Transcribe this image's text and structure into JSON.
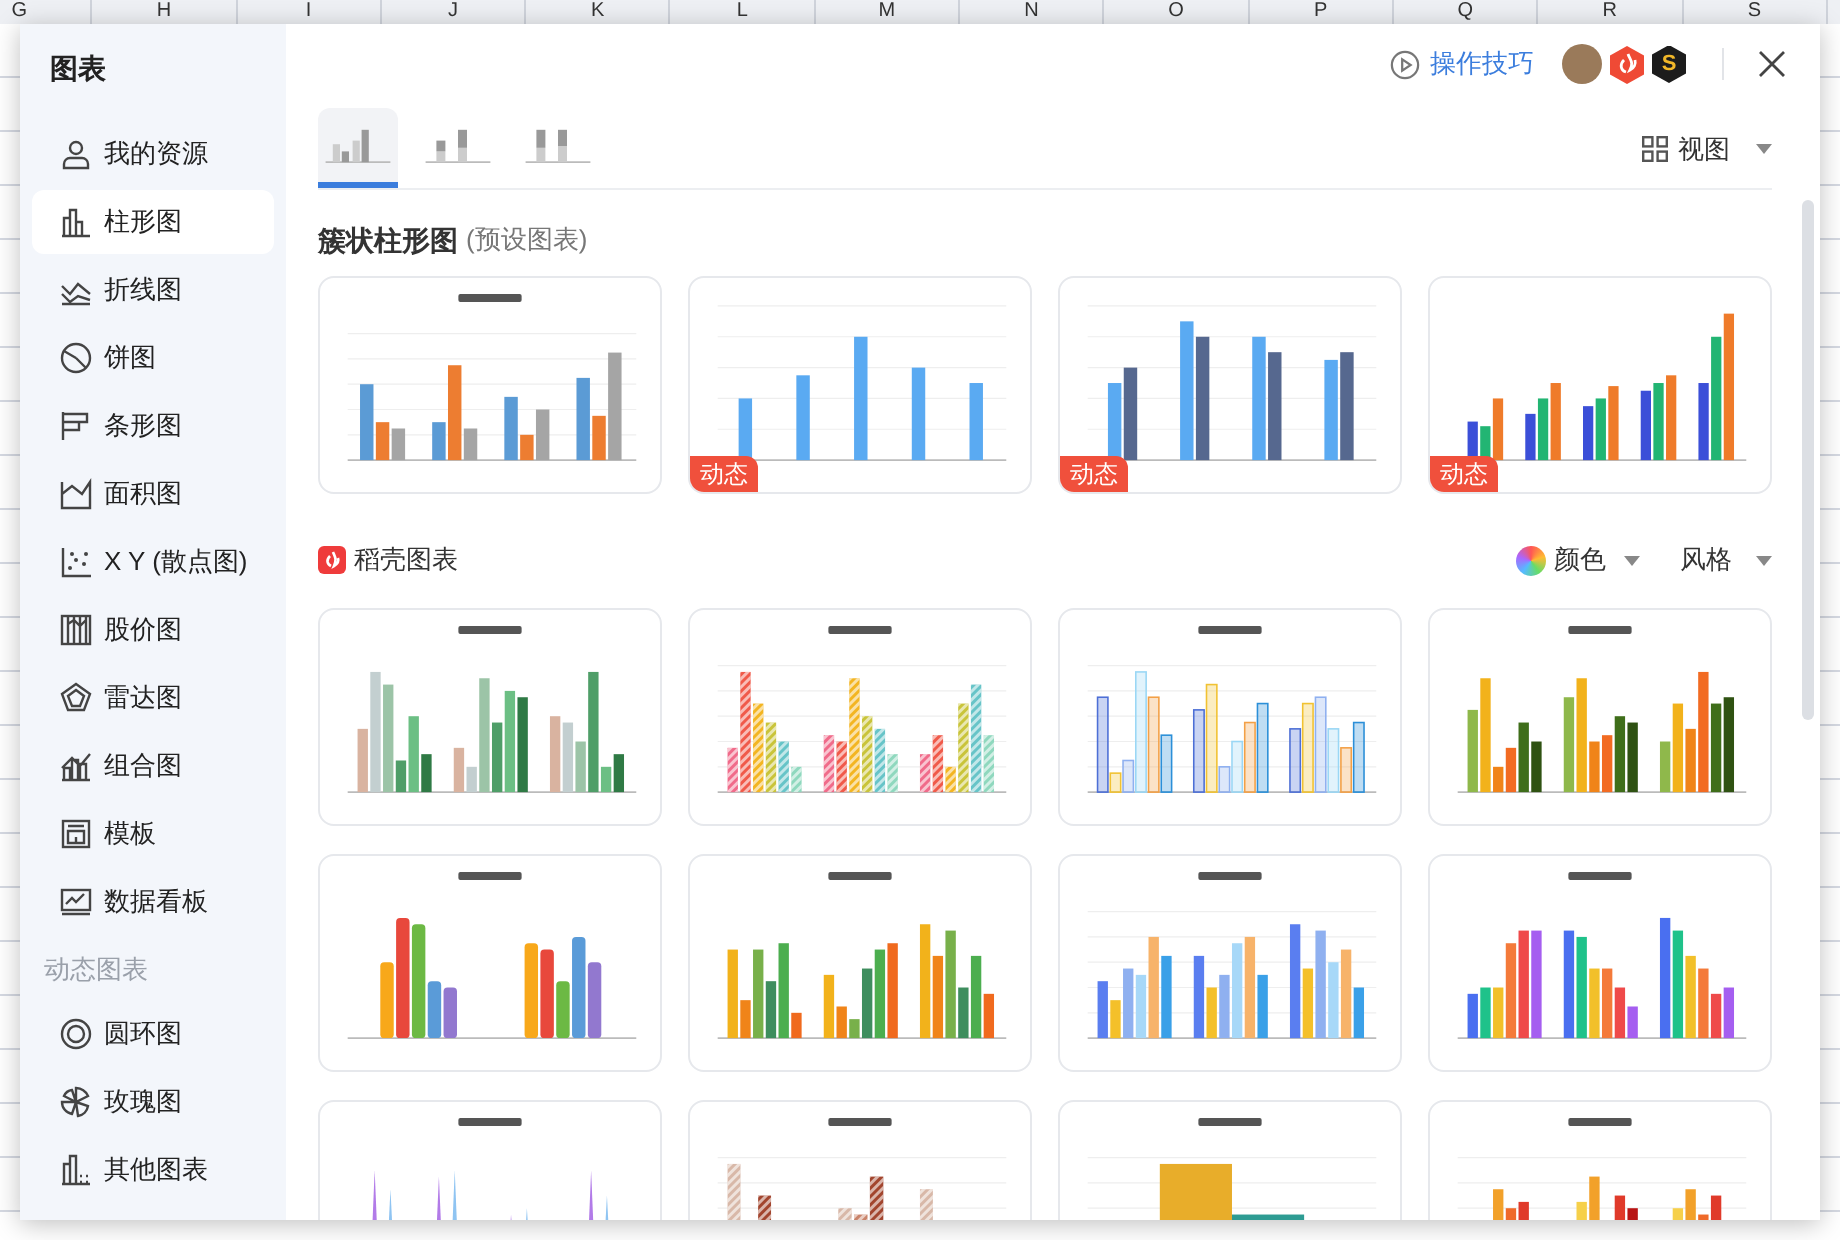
{
  "spreadsheet": {
    "column_headers": [
      "G",
      "H",
      "I",
      "J",
      "K",
      "L",
      "M",
      "N",
      "O",
      "P",
      "Q",
      "R",
      "S"
    ]
  },
  "dialog": {
    "title": "图表",
    "tips_link": "操作技巧",
    "badge_letter": "S"
  },
  "sidebar": {
    "sections": [
      {
        "items": [
          {
            "label": "我的资源",
            "selected": false
          },
          {
            "label": "柱形图",
            "selected": true
          },
          {
            "label": "折线图",
            "selected": false
          },
          {
            "label": "饼图",
            "selected": false
          },
          {
            "label": "条形图",
            "selected": false
          },
          {
            "label": "面积图",
            "selected": false
          },
          {
            "label": "X Y (散点图)",
            "selected": false
          },
          {
            "label": "股价图",
            "selected": false
          },
          {
            "label": "雷达图",
            "selected": false
          },
          {
            "label": "组合图",
            "selected": false
          },
          {
            "label": "模板",
            "selected": false
          },
          {
            "label": "数据看板",
            "selected": false
          }
        ]
      },
      {
        "header": "动态图表",
        "items": [
          {
            "label": "圆环图",
            "selected": false
          },
          {
            "label": "玫瑰图",
            "selected": false
          },
          {
            "label": "其他图表",
            "selected": false
          }
        ]
      }
    ]
  },
  "subtype_tabs": [
    {
      "selected": true
    },
    {
      "selected": false
    },
    {
      "selected": false
    }
  ],
  "view_menu": "视图",
  "preset": {
    "title": "簇状柱形图",
    "note": "(预设图表)",
    "cards": [
      {
        "kind": "grouped"
      },
      {
        "kind": "single",
        "badge": "动态"
      },
      {
        "kind": "pair",
        "badge": "动态"
      },
      {
        "kind": "growth",
        "badge": "动态"
      }
    ]
  },
  "gallery": {
    "title": "稻壳图表",
    "color_menu": "颜色",
    "style_menu": "风格",
    "cards": [
      {
        "kind": "earth"
      },
      {
        "kind": "hatched"
      },
      {
        "kind": "outline"
      },
      {
        "kind": "olive"
      },
      {
        "kind": "cylinder"
      },
      {
        "kind": "multi"
      },
      {
        "kind": "pastel"
      },
      {
        "kind": "bright"
      },
      {
        "kind": "spike"
      },
      {
        "kind": "brown"
      },
      {
        "kind": "histogram"
      },
      {
        "kind": "warm"
      }
    ]
  }
}
